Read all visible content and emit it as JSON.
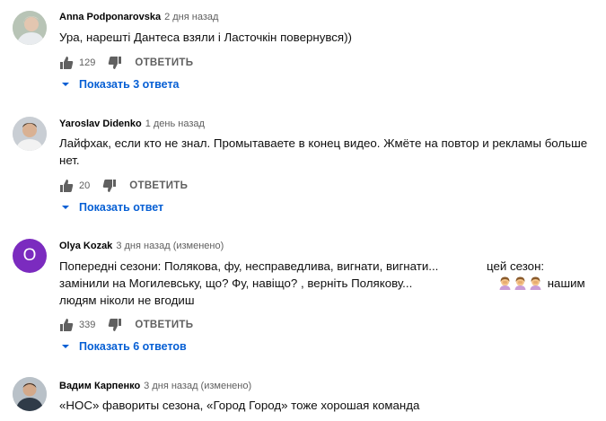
{
  "comments": [
    {
      "author": "Anna Podponarovska",
      "time": "2 дня назад",
      "lines": [
        "Ура, нарешті Дантеса взяли і Ласточкін повернувся))"
      ],
      "likes": "129",
      "reply_label": "ОТВЕТИТЬ",
      "replies_label": "Показать 3 ответа"
    },
    {
      "author": "Yaroslav Didenko",
      "time": "1 день назад",
      "lines": [
        "Лайфхак, если кто не знал. Промытаваете в конец видео. Жмёте на повтор и рекламы больше",
        "нет."
      ],
      "likes": "20",
      "reply_label": "ОТВЕТИТЬ",
      "replies_label": "Показать ответ"
    },
    {
      "author": "Olya Kozak",
      "time": "3 дня назад (изменено)",
      "avatar_letter": "O",
      "avatar_color": "#7b2bbf",
      "line1a": "Попередні сезони: Полякова, фу, несправедлива, вигнати, вигнати...",
      "line1b": "цей сезон:",
      "line2a": "замінили на Могилевську, що? Фу, навіщо? , верніть Полякову...",
      "line2b": "нашим",
      "line3": "людям ніколи не вгодиш",
      "likes": "339",
      "reply_label": "ОТВЕТИТЬ",
      "replies_label": "Показать 6 ответов"
    },
    {
      "author": "Вадим Карпенко",
      "time": "3 дня назад (изменено)",
      "lines": [
        "«НОС» фавориты сезона, «Город Город» тоже хорошая команда"
      ]
    }
  ],
  "colors": {
    "link": "#065fd4",
    "meta": "#606060"
  },
  "icons": {
    "like": "thumbs-up-icon",
    "dislike": "thumbs-down-icon",
    "expand": "chevron-down-icon",
    "emoji": "woman-facepalming-emoji"
  }
}
